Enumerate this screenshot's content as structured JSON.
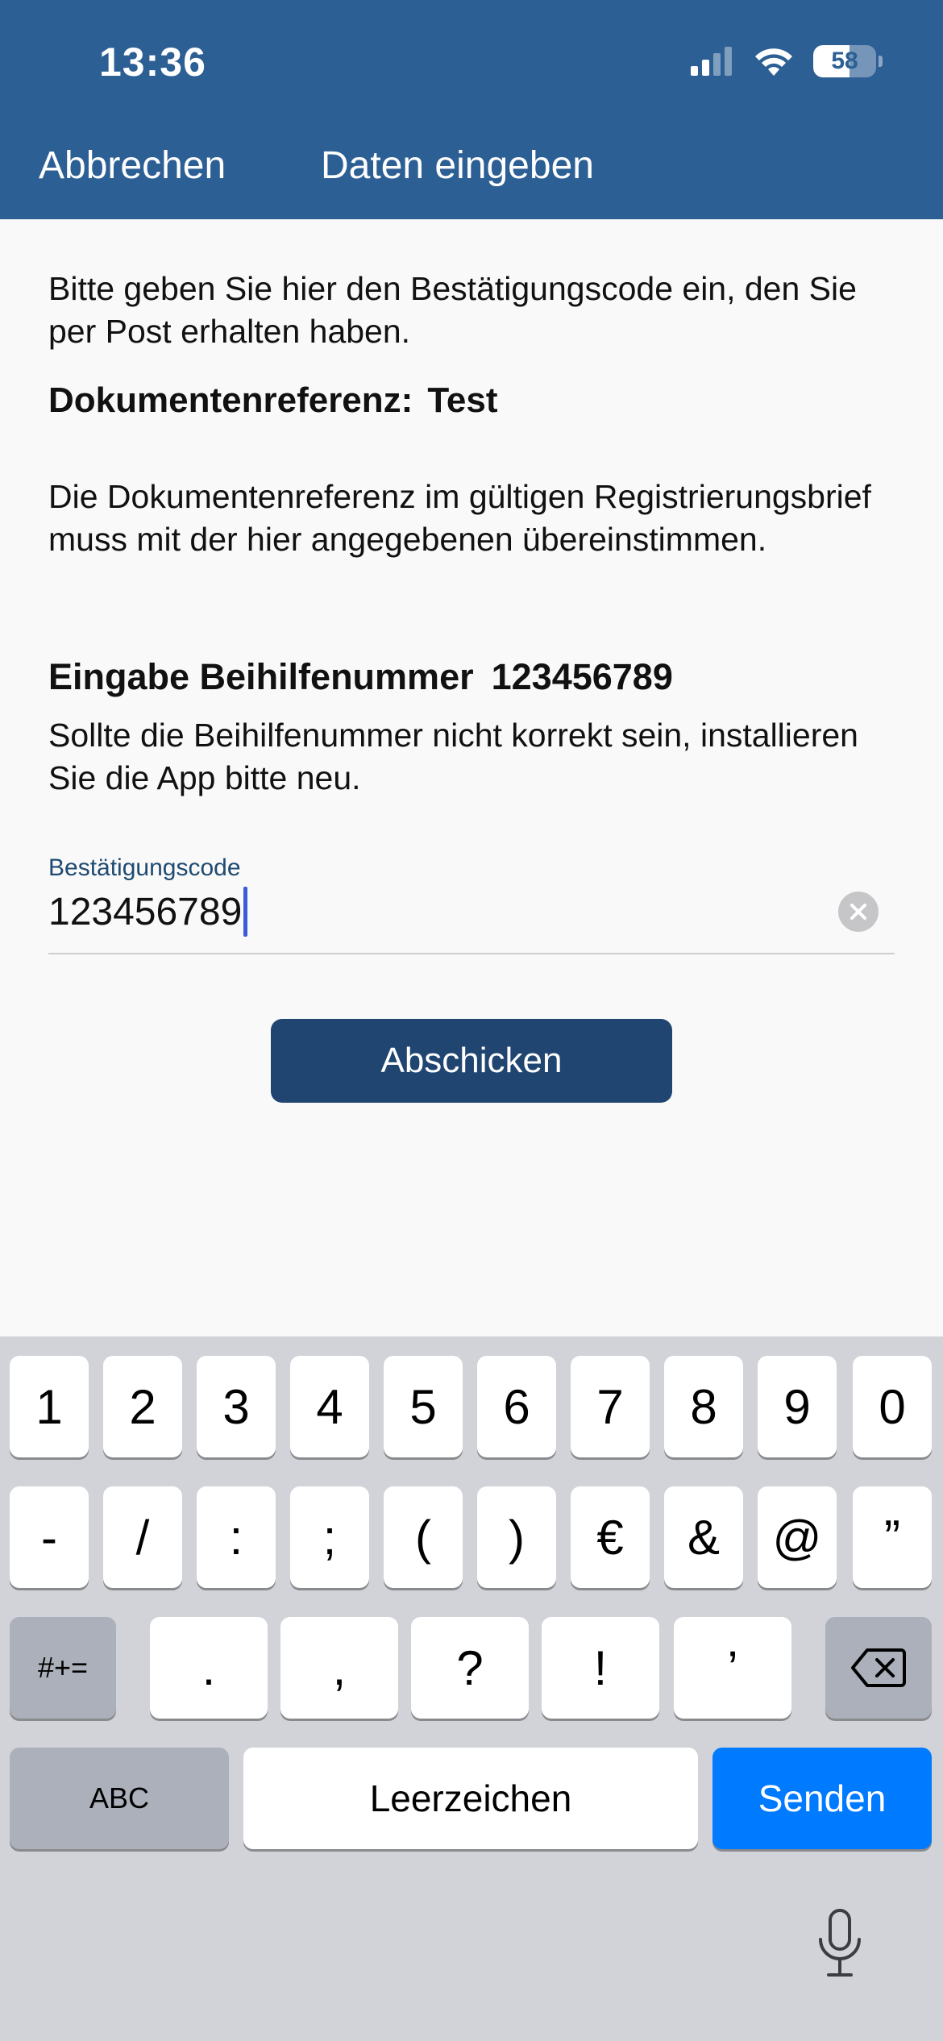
{
  "status_bar": {
    "time": "13:36",
    "battery": "58",
    "battery_level": 0.58,
    "icons": [
      "cellular-signal-icon",
      "wifi-icon",
      "battery-icon"
    ]
  },
  "nav": {
    "cancel_label": "Abbrechen",
    "title": "Daten eingeben"
  },
  "content": {
    "intro": "Bitte geben Sie hier den Bestätigungscode ein, den Sie per Post erhalten haben.",
    "docref_label": "Dokumentenreferenz:",
    "docref_value": "Test",
    "docref_info": "Die Dokumentenreferenz im gültigen Registrierungsbrief muss mit der hier angegebenen übereinstimmen.",
    "beihilfe_label": "Eingabe Beihilfenummer",
    "beihilfe_value": "123456789",
    "beihilfe_info": "Sollte die Beihilfenummer nicht korrekt sein, installieren Sie die App bitte neu."
  },
  "field": {
    "label": "Bestätigungscode",
    "value": "123456789",
    "clear_icon": "clear-circle-icon"
  },
  "submit_label": "Abschicken",
  "keyboard": {
    "row1": [
      "1",
      "2",
      "3",
      "4",
      "5",
      "6",
      "7",
      "8",
      "9",
      "0"
    ],
    "row2": [
      "-",
      "/",
      ":",
      ";",
      "(",
      ")",
      "€",
      "&",
      "@",
      "”"
    ],
    "row3_toggle": "#+=",
    "row3": [
      ".",
      ",",
      "?",
      "!",
      "’"
    ],
    "backspace_icon": "backspace-icon",
    "abc": "ABC",
    "space": "Leerzeichen",
    "send": "Senden",
    "mic_icon": "microphone-icon",
    "accent_color": "#007aff"
  },
  "colors": {
    "header": "#2c5f94",
    "button": "#1f4570"
  }
}
